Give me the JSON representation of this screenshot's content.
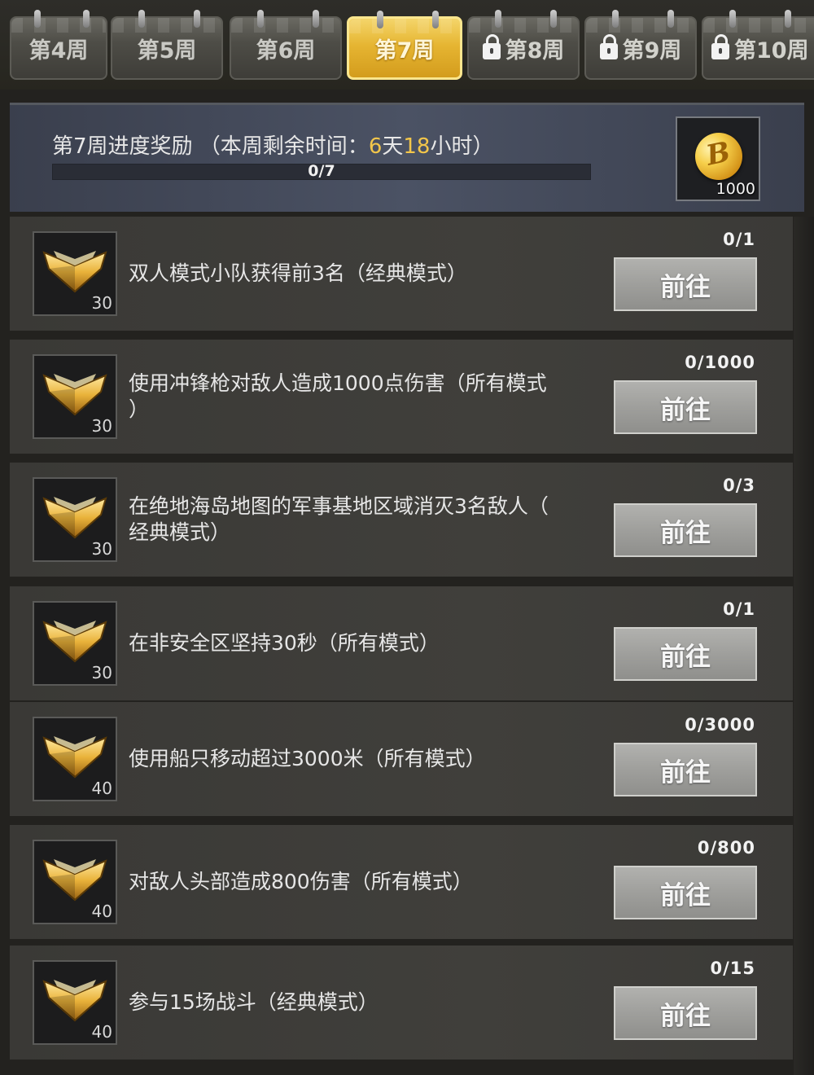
{
  "tabs": [
    {
      "label": "第4周",
      "locked": false,
      "active": false
    },
    {
      "label": "第5周",
      "locked": false,
      "active": false
    },
    {
      "label": "第6周",
      "locked": false,
      "active": false
    },
    {
      "label": "第7周",
      "locked": false,
      "active": true
    },
    {
      "label": "第8周",
      "locked": true,
      "active": false
    },
    {
      "label": "第9周",
      "locked": true,
      "active": false
    },
    {
      "label": "第10周",
      "locked": true,
      "active": false
    }
  ],
  "header": {
    "title_prefix": "第7周进度奖励 （本周剩余时间：",
    "days": "6",
    "days_unit": "天",
    "hours": "18",
    "hours_unit": "小时",
    "title_suffix": "）",
    "progress_text": "0/7",
    "progress_fraction": 0,
    "reward_amount": "1000",
    "reward_icon": "gold-coin-icon"
  },
  "tasks": [
    {
      "desc_line1": "双人模式小队获得前3名（经典模式）",
      "desc_line2": "",
      "points": "30",
      "progress": "0/1",
      "button": "前往"
    },
    {
      "desc_line1": "使用冲锋枪对敌人造成1000点伤害（所有模式",
      "desc_line2": "）",
      "points": "30",
      "progress": "0/1000",
      "button": "前往"
    },
    {
      "desc_line1": "在绝地海岛地图的军事基地区域消灭3名敌人（",
      "desc_line2": "经典模式）",
      "points": "30",
      "progress": "0/3",
      "button": "前往"
    },
    {
      "desc_line1": "在非安全区坚持30秒（所有模式）",
      "desc_line2": "",
      "points": "30",
      "progress": "0/1",
      "button": "前往"
    },
    {
      "desc_line1": "使用船只移动超过3000米（所有模式）",
      "desc_line2": "",
      "points": "40",
      "progress": "0/3000",
      "button": "前往"
    },
    {
      "desc_line1": "对敌人头部造成800伤害（所有模式）",
      "desc_line2": "",
      "points": "40",
      "progress": "0/800",
      "button": "前往"
    },
    {
      "desc_line1": "参与15场战斗（经典模式）",
      "desc_line2": "",
      "points": "40",
      "progress": "0/15",
      "button": "前往"
    }
  ],
  "colors": {
    "active_tab": "#e6b532",
    "highlight_text": "#f3c64a",
    "button": "#9f9f9c"
  }
}
